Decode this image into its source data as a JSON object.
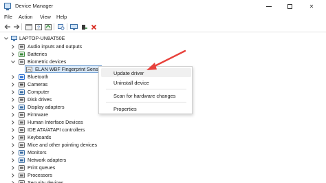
{
  "window": {
    "title": "Device Manager",
    "controls": {
      "minimize": "minimize",
      "maximize": "maximize",
      "close": "✕"
    }
  },
  "menubar": {
    "items": [
      "File",
      "Action",
      "View",
      "Help"
    ]
  },
  "toolbar": {
    "buttons": [
      "back-arrow-icon",
      "forward-arrow-icon",
      "properties-icon",
      "help-icon",
      "update-driver-icon",
      "scan-icon",
      "monitor-icon",
      "enable-device-icon",
      "uninstall-icon"
    ]
  },
  "tree": {
    "root": "LAPTOP-UN8AT50E",
    "categories": [
      "Audio inputs and outputs",
      "Batteries",
      "Biometric devices",
      "Bluetooth",
      "Cameras",
      "Computer",
      "Disk drives",
      "Display adapters",
      "Firmware",
      "Human Interface Devices",
      "IDE ATA/ATAPI controllers",
      "Keyboards",
      "Mice and other pointing devices",
      "Monitors",
      "Network adapters",
      "Print queues",
      "Processors",
      "Security devices"
    ],
    "selected_child": "ELAN WBF Fingerprint Senso"
  },
  "context_menu": {
    "items": [
      "Update driver",
      "Uninstall device",
      "Scan for hardware changes",
      "Properties"
    ]
  },
  "colors": {
    "selection_bg": "#d9e8f7",
    "selection_border": "#7aa6d6",
    "annotation_arrow": "#e8423c",
    "uninstall_red": "#d93025"
  }
}
